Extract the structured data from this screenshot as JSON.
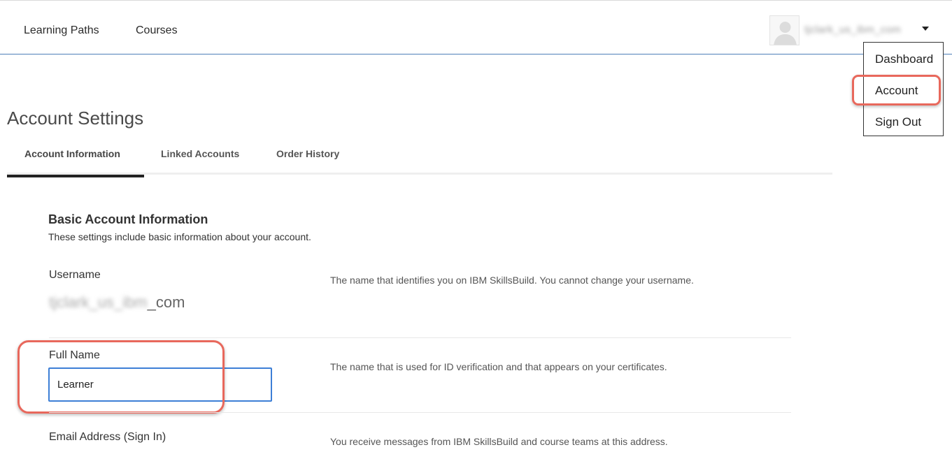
{
  "nav": {
    "learning_paths": "Learning Paths",
    "courses": "Courses"
  },
  "user": {
    "display_name": "tjclark_us_ibm_com"
  },
  "user_menu": {
    "items": [
      "Dashboard",
      "Account",
      "Sign Out"
    ]
  },
  "page": {
    "title": "Account Settings"
  },
  "tabs": [
    "Account Information",
    "Linked Accounts",
    "Order History"
  ],
  "section": {
    "title": "Basic Account Information",
    "description": "These settings include basic information about your account."
  },
  "fields": {
    "username": {
      "label": "Username",
      "value_blurred": "tjclark_us_ibm",
      "value_suffix": "_com",
      "help": "The name that identifies you on IBM SkillsBuild. You cannot change your username."
    },
    "full_name": {
      "label": "Full Name",
      "value": "Learner",
      "help": "The name that is used for ID verification and that appears on your certificates."
    },
    "email": {
      "label": "Email Address (Sign In)",
      "help": "You receive messages from IBM SkillsBuild and course teams at this address."
    }
  },
  "colors": {
    "accent": "#3d7fd6",
    "highlight": "#e8685c",
    "header_border": "#4e7fb8"
  }
}
